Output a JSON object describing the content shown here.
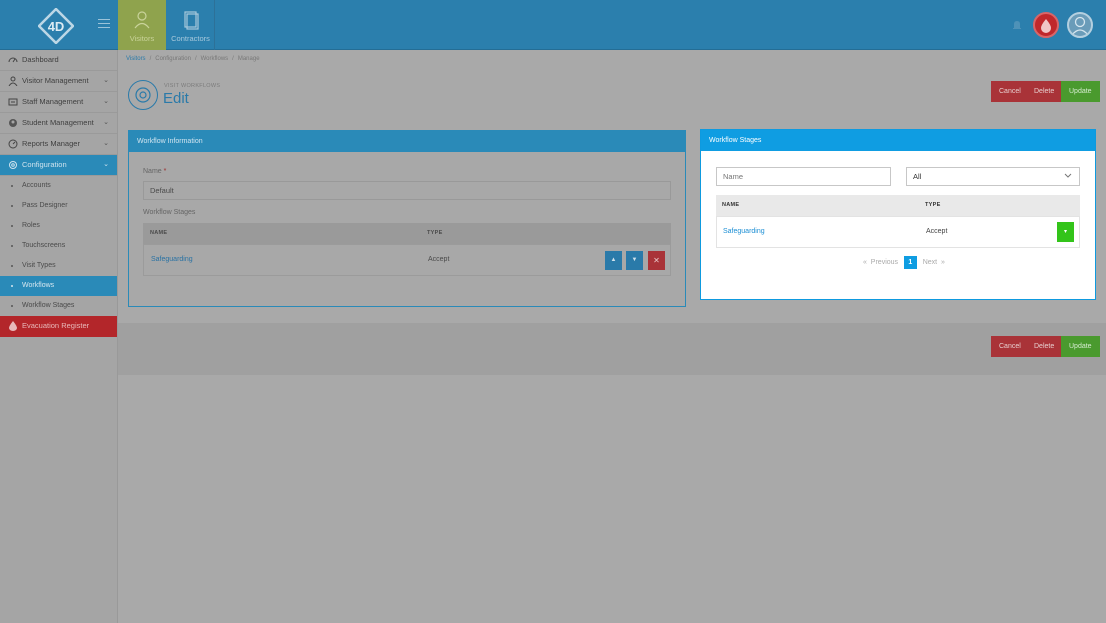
{
  "header": {
    "nav": [
      {
        "label": "Visitors"
      },
      {
        "label": "Contractors"
      }
    ]
  },
  "sidebar": {
    "items": [
      {
        "label": "Dashboard"
      },
      {
        "label": "Visitor Management"
      },
      {
        "label": "Staff Management"
      },
      {
        "label": "Student Management"
      },
      {
        "label": "Reports Manager"
      },
      {
        "label": "Configuration"
      }
    ],
    "sub_items": [
      {
        "label": "Accounts"
      },
      {
        "label": "Pass Designer"
      },
      {
        "label": "Roles"
      },
      {
        "label": "Touchscreens"
      },
      {
        "label": "Visit Types"
      },
      {
        "label": "Workflows"
      },
      {
        "label": "Workflow Stages"
      }
    ],
    "evacuation": "Evacuation Register"
  },
  "breadcrumb": [
    "Visitors",
    "Configuration",
    "Workflows",
    "Manage"
  ],
  "page": {
    "subtitle": "VISIT WORKFLOWS",
    "title": "Edit"
  },
  "actions": {
    "cancel": "Cancel",
    "delete": "Delete",
    "update": "Update"
  },
  "workflow_info": {
    "header": "Workflow Information",
    "name_label": "Name",
    "required_mark": "*",
    "name_value": "Default",
    "stages_label": "Workflow Stages",
    "columns": [
      "NAME",
      "TYPE"
    ],
    "rows": [
      {
        "name": "Safeguarding",
        "type": "Accept"
      }
    ]
  },
  "workflow_stages": {
    "header": "Workflow Stages",
    "search_placeholder": "Name",
    "filter_value": "All",
    "columns": [
      "NAME",
      "TYPE"
    ],
    "rows": [
      {
        "name": "Safeguarding",
        "type": "Accept"
      }
    ],
    "pager": {
      "prev": "«",
      "previous": "Previous",
      "current": "1",
      "next": "Next",
      "next_arrow": "»"
    }
  }
}
